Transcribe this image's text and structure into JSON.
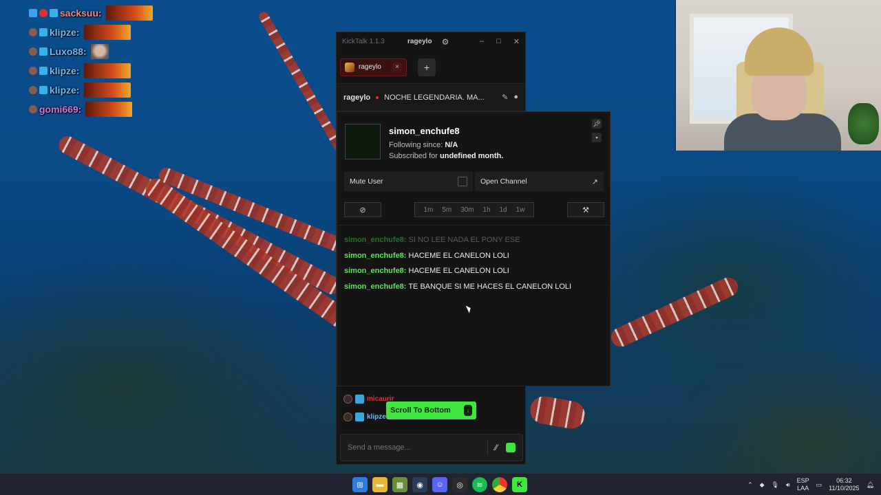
{
  "overlay_chat": [
    {
      "name": "sacksuu:",
      "color": "#e98b8b",
      "emote": "wide"
    },
    {
      "name": "klipze:",
      "color": "#6fb9f0",
      "emote": "wide"
    },
    {
      "name": "Luxo88:",
      "color": "#6fb9f0",
      "emote": "face"
    },
    {
      "name": "klipze:",
      "color": "#6fb9f0",
      "emote": "wide"
    },
    {
      "name": "klipze:",
      "color": "#6fb9f0",
      "emote": "wide"
    },
    {
      "name": "gomi669:",
      "color": "#d774d7",
      "emote": "wide"
    }
  ],
  "kicktalk": {
    "app_title": "KickTalk 1.1.3",
    "current_user": "rageylo",
    "tab": {
      "label": "rageylo",
      "close": "×"
    },
    "add_tab": "+",
    "channel": {
      "name": "rageylo",
      "stream_title": "NOCHE LEGENDARIA. MA..."
    },
    "bottom_rows": [
      {
        "name": "micaurir",
        "color": "#e0303a"
      },
      {
        "name": "klipze:",
        "color": "#6fb9f0"
      }
    ],
    "scroll_to_bottom": "Scroll To Bottom",
    "composer_placeholder": "Send a message..."
  },
  "user_popup": {
    "username": "simon_enchufe8",
    "following_label": "Following since:",
    "following_value": "N/A",
    "subscribed_prefix": "Subscribed for",
    "subscribed_value": "undefined month.",
    "mute_label": "Mute User",
    "open_channel_label": "Open Channel",
    "timeouts": [
      "1m",
      "5m",
      "30m",
      "1h",
      "1d",
      "1w"
    ],
    "messages": [
      {
        "user": "simon_enchufe8:",
        "text": "SI NO LEE NADA EL PONY ESE",
        "faded": true
      },
      {
        "user": "simon_enchufe8:",
        "text": "HACEME EL CANELON LOLI",
        "faded": false
      },
      {
        "user": "simon_enchufe8:",
        "text": "HACEME EL CANELON LOLI",
        "faded": false
      },
      {
        "user": "simon_enchufe8:",
        "text": "TE BANQUE SI ME HACES EL CANELON LOLI",
        "faded": false
      }
    ]
  },
  "taskbar": {
    "apps": [
      "windows-start",
      "file-explorer",
      "minecraft",
      "steam",
      "discord",
      "obs",
      "spotify",
      "chrome",
      "kicktalk"
    ],
    "lang": "ESP",
    "lang_sub": "LAA",
    "time": "06:32",
    "date": "11/10/2025"
  },
  "colors": {
    "kick_green": "#3ee63e",
    "accent_red": "#e0303a"
  }
}
